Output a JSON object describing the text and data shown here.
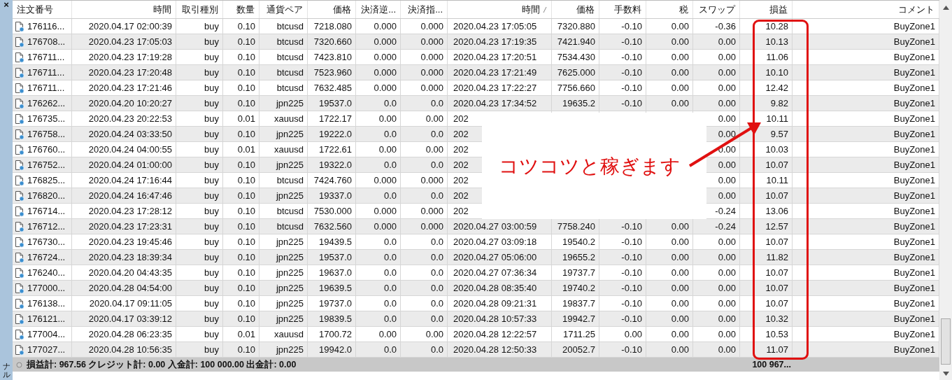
{
  "sidebar": {
    "close": "×",
    "label": "ナル"
  },
  "table": {
    "columns": [
      {
        "label": "注文番号",
        "sorted": false
      },
      {
        "label": "時間",
        "sorted": false
      },
      {
        "label": "取引種別",
        "sorted": false
      },
      {
        "label": "数量",
        "sorted": false
      },
      {
        "label": "通貨ペア",
        "sorted": false
      },
      {
        "label": "価格",
        "sorted": false
      },
      {
        "label": "決済逆...",
        "sorted": false
      },
      {
        "label": "決済指...",
        "sorted": false
      },
      {
        "label": "時間",
        "sorted": true
      },
      {
        "label": "価格",
        "sorted": false
      },
      {
        "label": "手数料",
        "sorted": false
      },
      {
        "label": "税",
        "sorted": false
      },
      {
        "label": "スワップ",
        "sorted": false
      },
      {
        "label": "損益",
        "sorted": false
      },
      {
        "label": "コメント",
        "sorted": false
      }
    ],
    "rows": [
      {
        "cells": [
          "176116...",
          "2020.04.17 02:00:39",
          "buy",
          "0.10",
          "btcusd",
          "7218.080",
          "0.000",
          "0.000",
          "2020.04.23 17:05:05",
          "7320.880",
          "-0.10",
          "0.00",
          "-0.36",
          "10.28",
          "BuyZone1"
        ]
      },
      {
        "cells": [
          "176708...",
          "2020.04.23 17:05:03",
          "buy",
          "0.10",
          "btcusd",
          "7320.660",
          "0.000",
          "0.000",
          "2020.04.23 17:19:35",
          "7421.940",
          "-0.10",
          "0.00",
          "0.00",
          "10.13",
          "BuyZone1"
        ]
      },
      {
        "cells": [
          "176711...",
          "2020.04.23 17:19:28",
          "buy",
          "0.10",
          "btcusd",
          "7423.810",
          "0.000",
          "0.000",
          "2020.04.23 17:20:51",
          "7534.430",
          "-0.10",
          "0.00",
          "0.00",
          "11.06",
          "BuyZone1"
        ]
      },
      {
        "cells": [
          "176711...",
          "2020.04.23 17:20:48",
          "buy",
          "0.10",
          "btcusd",
          "7523.960",
          "0.000",
          "0.000",
          "2020.04.23 17:21:49",
          "7625.000",
          "-0.10",
          "0.00",
          "0.00",
          "10.10",
          "BuyZone1"
        ]
      },
      {
        "cells": [
          "176711...",
          "2020.04.23 17:21:46",
          "buy",
          "0.10",
          "btcusd",
          "7632.485",
          "0.000",
          "0.000",
          "2020.04.23 17:22:27",
          "7756.660",
          "-0.10",
          "0.00",
          "0.00",
          "12.42",
          "BuyZone1"
        ]
      },
      {
        "cells": [
          "176262...",
          "2020.04.20 10:20:27",
          "buy",
          "0.10",
          "jpn225",
          "19537.0",
          "0.0",
          "0.0",
          "2020.04.23 17:34:52",
          "19635.2",
          "-0.10",
          "0.00",
          "0.00",
          "9.82",
          "BuyZone1"
        ]
      },
      {
        "cells": [
          "176735...",
          "2020.04.23 20:22:53",
          "buy",
          "0.01",
          "xauusd",
          "1722.17",
          "0.00",
          "0.00",
          "202",
          null,
          null,
          null,
          "0.00",
          "10.11",
          "BuyZone1"
        ]
      },
      {
        "cells": [
          "176758...",
          "2020.04.24 03:33:50",
          "buy",
          "0.10",
          "jpn225",
          "19222.0",
          "0.0",
          "0.0",
          "202",
          null,
          null,
          null,
          "0.00",
          "9.57",
          "BuyZone1"
        ]
      },
      {
        "cells": [
          "176760...",
          "2020.04.24 04:00:55",
          "buy",
          "0.01",
          "xauusd",
          "1722.61",
          "0.00",
          "0.00",
          "202",
          null,
          null,
          null,
          "0.00",
          "10.03",
          "BuyZone1"
        ]
      },
      {
        "cells": [
          "176752...",
          "2020.04.24 01:00:00",
          "buy",
          "0.10",
          "jpn225",
          "19322.0",
          "0.0",
          "0.0",
          "202",
          null,
          null,
          null,
          "0.00",
          "10.07",
          "BuyZone1"
        ]
      },
      {
        "cells": [
          "176825...",
          "2020.04.24 17:16:44",
          "buy",
          "0.10",
          "btcusd",
          "7424.760",
          "0.000",
          "0.000",
          "202",
          null,
          null,
          null,
          "0.00",
          "10.11",
          "BuyZone1"
        ]
      },
      {
        "cells": [
          "176820...",
          "2020.04.24 16:47:46",
          "buy",
          "0.10",
          "jpn225",
          "19337.0",
          "0.0",
          "0.0",
          "202",
          null,
          null,
          null,
          "0.00",
          "10.07",
          "BuyZone1"
        ]
      },
      {
        "cells": [
          "176714...",
          "2020.04.23 17:28:12",
          "buy",
          "0.10",
          "btcusd",
          "7530.000",
          "0.000",
          "0.000",
          "202",
          null,
          null,
          null,
          "-0.24",
          "13.06",
          "BuyZone1"
        ]
      },
      {
        "cells": [
          "176712...",
          "2020.04.23 17:23:31",
          "buy",
          "0.10",
          "btcusd",
          "7632.560",
          "0.000",
          "0.000",
          "2020.04.27 03:00:59",
          "7758.240",
          "-0.10",
          "0.00",
          "-0.24",
          "12.57",
          "BuyZone1"
        ]
      },
      {
        "cells": [
          "176730...",
          "2020.04.23 19:45:46",
          "buy",
          "0.10",
          "jpn225",
          "19439.5",
          "0.0",
          "0.0",
          "2020.04.27 03:09:18",
          "19540.2",
          "-0.10",
          "0.00",
          "0.00",
          "10.07",
          "BuyZone1"
        ]
      },
      {
        "cells": [
          "176724...",
          "2020.04.23 18:39:34",
          "buy",
          "0.10",
          "jpn225",
          "19537.0",
          "0.0",
          "0.0",
          "2020.04.27 05:06:00",
          "19655.2",
          "-0.10",
          "0.00",
          "0.00",
          "11.82",
          "BuyZone1"
        ]
      },
      {
        "cells": [
          "176240...",
          "2020.04.20 04:43:35",
          "buy",
          "0.10",
          "jpn225",
          "19637.0",
          "0.0",
          "0.0",
          "2020.04.27 07:36:34",
          "19737.7",
          "-0.10",
          "0.00",
          "0.00",
          "10.07",
          "BuyZone1"
        ]
      },
      {
        "cells": [
          "177000...",
          "2020.04.28 04:54:00",
          "buy",
          "0.10",
          "jpn225",
          "19639.5",
          "0.0",
          "0.0",
          "2020.04.28 08:35:40",
          "19740.2",
          "-0.10",
          "0.00",
          "0.00",
          "10.07",
          "BuyZone1"
        ]
      },
      {
        "cells": [
          "176138...",
          "2020.04.17 09:11:05",
          "buy",
          "0.10",
          "jpn225",
          "19737.0",
          "0.0",
          "0.0",
          "2020.04.28 09:21:31",
          "19837.7",
          "-0.10",
          "0.00",
          "0.00",
          "10.07",
          "BuyZone1"
        ]
      },
      {
        "cells": [
          "176121...",
          "2020.04.17 03:39:12",
          "buy",
          "0.10",
          "jpn225",
          "19839.5",
          "0.0",
          "0.0",
          "2020.04.28 10:57:33",
          "19942.7",
          "-0.10",
          "0.00",
          "0.00",
          "10.32",
          "BuyZone1"
        ]
      },
      {
        "cells": [
          "177004...",
          "2020.04.28 06:23:35",
          "buy",
          "0.01",
          "xauusd",
          "1700.72",
          "0.00",
          "0.00",
          "2020.04.28 12:22:57",
          "1711.25",
          "0.00",
          "0.00",
          "0.00",
          "10.53",
          "BuyZone1"
        ]
      },
      {
        "cells": [
          "177027...",
          "2020.04.28 10:56:35",
          "buy",
          "0.10",
          "jpn225",
          "19942.0",
          "0.0",
          "0.0",
          "2020.04.28 12:50:33",
          "20052.7",
          "-0.10",
          "0.00",
          "0.00",
          "11.07",
          "BuyZone1"
        ]
      }
    ]
  },
  "summary": {
    "text": "損益計: 967.56  クレジット計: 0.00  入金計: 100 000.00  出金計: 0.00",
    "balance": "100 967..."
  },
  "annotation": {
    "text": "コツコツと稼ぎます"
  }
}
